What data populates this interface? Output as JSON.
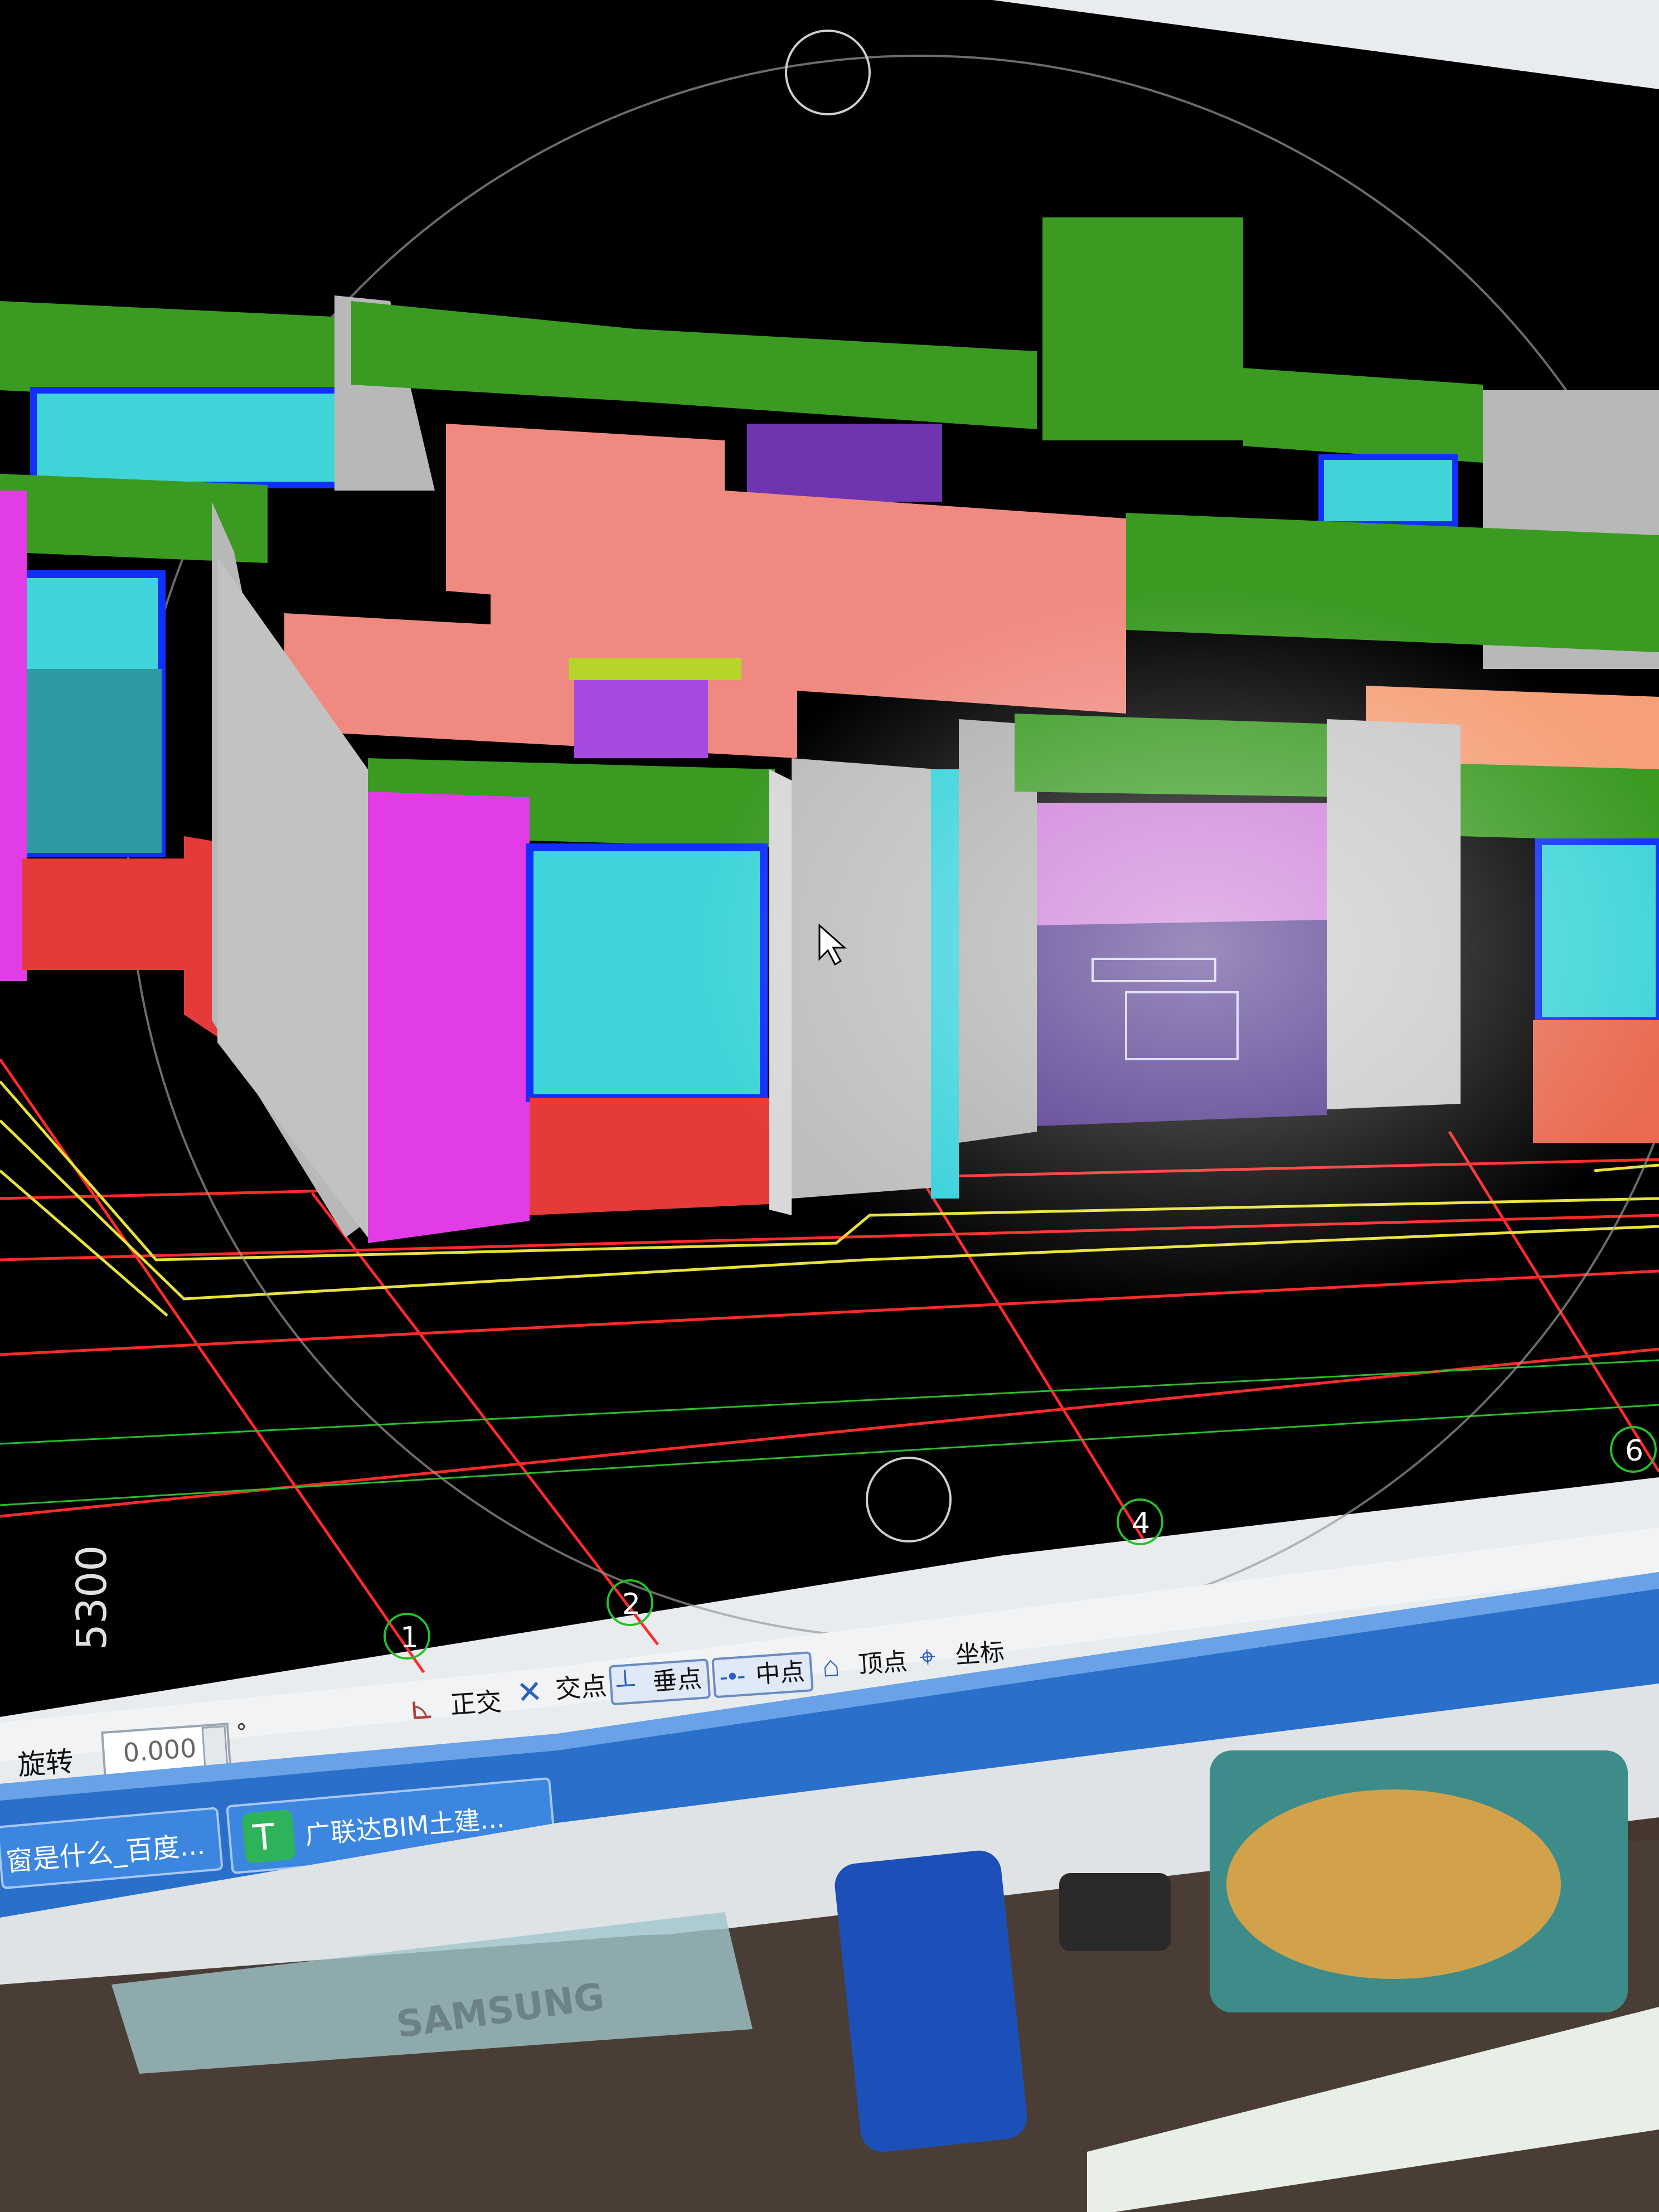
{
  "viewport": {
    "dimension_label": "5300",
    "axis_labels": [
      "1",
      "2",
      "4",
      "6"
    ]
  },
  "snap_toolbar": {
    "items": [
      {
        "label": "正交",
        "icon": "ortho-snap-icon",
        "active": false
      },
      {
        "label": "交点",
        "icon": "intersection-snap-icon",
        "active": false
      },
      {
        "label": "垂点",
        "icon": "perpendicular-snap-icon",
        "active": true
      },
      {
        "label": "中点",
        "icon": "midpoint-snap-icon",
        "active": true
      },
      {
        "label": "顶点",
        "icon": "vertex-snap-icon",
        "active": false
      },
      {
        "label": "坐标",
        "icon": "coordinate-snap-icon",
        "active": false
      }
    ]
  },
  "rotation": {
    "label": "旋转",
    "value": "0.000",
    "unit": "°"
  },
  "taskbar": {
    "items": [
      {
        "label": "窗是什么_百度..."
      },
      {
        "label": "广联达BIM土建..."
      }
    ]
  },
  "monitor": {
    "brand": "SAMSUNG"
  },
  "colors": {
    "viewport_bg": "#000000",
    "wall_grey": "#b8b8b8",
    "wall_pink": "#f08a80",
    "beam_green": "#3a9a22",
    "column_magenta": "#e23ce6",
    "window_cyan": "#3fd5d8",
    "grid_red": "#ff2a2a",
    "axis_yellow": "#e8e33a",
    "taskbar_blue": "#2a6fc9"
  }
}
